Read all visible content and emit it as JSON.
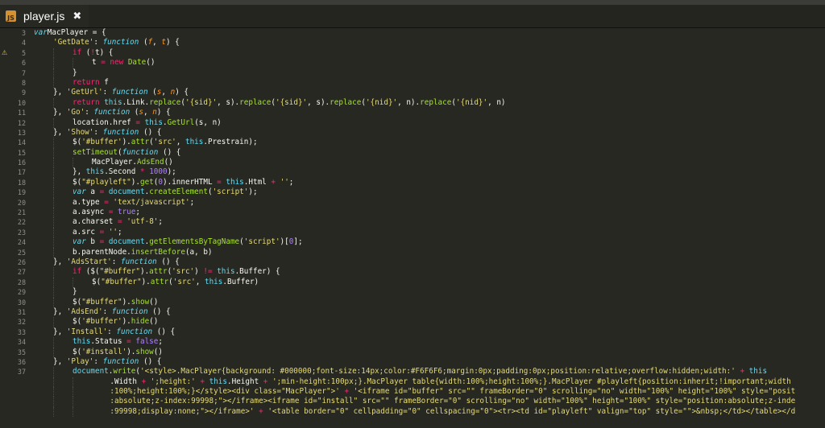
{
  "tab": {
    "icon_text": "JS",
    "name": "player.js",
    "close": "✖"
  },
  "warning_line": 5,
  "warning_glyph": "⚠",
  "lines": [
    {
      "n": "3",
      "indent": 0,
      "t": [
        [
          "v",
          "var"
        ],
        [
          "",
          "MacPlayer = {"
        ]
      ]
    },
    {
      "n": "4",
      "indent": 1,
      "t": [
        [
          "s",
          "'GetDate'"
        ],
        [
          "",
          ": "
        ],
        [
          "v",
          "function"
        ],
        [
          "",
          " ("
        ],
        [
          "p",
          "f"
        ],
        [
          "",
          ", "
        ],
        [
          "p",
          "t"
        ],
        [
          "",
          ") {"
        ]
      ]
    },
    {
      "n": "5",
      "indent": 2,
      "t": [
        [
          "k",
          "if"
        ],
        [
          "",
          " ("
        ],
        [
          "k",
          "!"
        ],
        [
          "",
          "t) {"
        ]
      ]
    },
    {
      "n": "6",
      "indent": 3,
      "t": [
        [
          "",
          "t "
        ],
        [
          "k",
          "="
        ],
        [
          " ",
          ""
        ],
        [
          "k",
          "new"
        ],
        [
          " ",
          ""
        ],
        [
          "f",
          "Date"
        ],
        [
          "",
          "()"
        ]
      ]
    },
    {
      "n": "7",
      "indent": 2,
      "t": [
        [
          "",
          "}"
        ]
      ]
    },
    {
      "n": "8",
      "indent": 2,
      "t": [
        [
          "k",
          "return"
        ],
        [
          "",
          " f"
        ]
      ]
    },
    {
      "n": "9",
      "indent": 1,
      "t": [
        [
          "",
          "}, "
        ],
        [
          "s",
          "'GetUrl'"
        ],
        [
          "",
          ": "
        ],
        [
          "v",
          "function"
        ],
        [
          "",
          " ("
        ],
        [
          "p",
          "s"
        ],
        [
          "",
          ", "
        ],
        [
          "p",
          "n"
        ],
        [
          "",
          ") {"
        ]
      ]
    },
    {
      "n": "10",
      "indent": 2,
      "t": [
        [
          "k",
          "return"
        ],
        [
          " ",
          ""
        ],
        [
          "c",
          "this"
        ],
        [
          "",
          ".Link."
        ],
        [
          "f",
          "replace"
        ],
        [
          "",
          "("
        ],
        [
          "s",
          "'{sid}'"
        ],
        [
          "",
          ", s)."
        ],
        [
          "f",
          "replace"
        ],
        [
          "",
          "("
        ],
        [
          "s",
          "'{sid}'"
        ],
        [
          "",
          ", s)."
        ],
        [
          "f",
          "replace"
        ],
        [
          "",
          "("
        ],
        [
          "s",
          "'{nid}'"
        ],
        [
          "",
          ", n)."
        ],
        [
          "f",
          "replace"
        ],
        [
          "",
          "("
        ],
        [
          "s",
          "'{nid}'"
        ],
        [
          "",
          ", n)"
        ]
      ]
    },
    {
      "n": "11",
      "indent": 1,
      "t": [
        [
          "",
          "}, "
        ],
        [
          "s",
          "'Go'"
        ],
        [
          "",
          ": "
        ],
        [
          "v",
          "function"
        ],
        [
          "",
          " ("
        ],
        [
          "p",
          "s"
        ],
        [
          "",
          ", "
        ],
        [
          "p",
          "n"
        ],
        [
          "",
          ") {"
        ]
      ]
    },
    {
      "n": "12",
      "indent": 2,
      "t": [
        [
          "",
          "location.href "
        ],
        [
          "k",
          "="
        ],
        [
          " ",
          ""
        ],
        [
          "c",
          "this"
        ],
        [
          "",
          "."
        ],
        [
          "f",
          "GetUrl"
        ],
        [
          "",
          "(s, n)"
        ]
      ]
    },
    {
      "n": "13",
      "indent": 1,
      "t": [
        [
          "",
          "}, "
        ],
        [
          "s",
          "'Show'"
        ],
        [
          "",
          ": "
        ],
        [
          "v",
          "function"
        ],
        [
          "",
          " () {"
        ]
      ]
    },
    {
      "n": "14",
      "indent": 2,
      "t": [
        [
          "",
          "$("
        ],
        [
          "s",
          "'#buffer'"
        ],
        [
          "",
          ")."
        ],
        [
          "f",
          "attr"
        ],
        [
          "",
          "("
        ],
        [
          "s",
          "'src'"
        ],
        [
          "",
          ", "
        ],
        [
          "c",
          "this"
        ],
        [
          "",
          ".Prestrain);"
        ]
      ]
    },
    {
      "n": "15",
      "indent": 2,
      "t": [
        [
          "f",
          "setTimeout"
        ],
        [
          "",
          "("
        ],
        [
          "v",
          "function"
        ],
        [
          "",
          " () {"
        ]
      ]
    },
    {
      "n": "16",
      "indent": 3,
      "t": [
        [
          "",
          "MacPlayer."
        ],
        [
          "f",
          "AdsEnd"
        ],
        [
          "",
          "()"
        ]
      ]
    },
    {
      "n": "17",
      "indent": 2,
      "t": [
        [
          "",
          "}, "
        ],
        [
          "c",
          "this"
        ],
        [
          "",
          ".Second "
        ],
        [
          "k",
          "*"
        ],
        [
          " ",
          ""
        ],
        [
          "n",
          "1000"
        ],
        [
          "",
          ");"
        ]
      ]
    },
    {
      "n": "18",
      "indent": 2,
      "t": [
        [
          "",
          "$("
        ],
        [
          "s",
          "\"#playleft\""
        ],
        [
          "",
          ")."
        ],
        [
          "f",
          "get"
        ],
        [
          "",
          "("
        ],
        [
          "n",
          "0"
        ],
        [
          "",
          ").innerHTML "
        ],
        [
          "k",
          "="
        ],
        [
          " ",
          ""
        ],
        [
          "c",
          "this"
        ],
        [
          "",
          ".Html "
        ],
        [
          "k",
          "+"
        ],
        [
          " ",
          ""
        ],
        [
          "s",
          "''"
        ],
        [
          "",
          ";"
        ]
      ]
    },
    {
      "n": "19",
      "indent": 2,
      "t": [
        [
          "v",
          "var"
        ],
        [
          "",
          " a "
        ],
        [
          "k",
          "="
        ],
        [
          " ",
          ""
        ],
        [
          "c",
          "document"
        ],
        [
          "",
          "."
        ],
        [
          "f",
          "createElement"
        ],
        [
          "",
          "("
        ],
        [
          "s",
          "'script'"
        ],
        [
          "",
          ");"
        ]
      ]
    },
    {
      "n": "20",
      "indent": 2,
      "t": [
        [
          "",
          "a.type "
        ],
        [
          "k",
          "="
        ],
        [
          " ",
          ""
        ],
        [
          "s",
          "'text/javascript'"
        ],
        [
          "",
          ";"
        ]
      ]
    },
    {
      "n": "21",
      "indent": 2,
      "t": [
        [
          "",
          "a.async "
        ],
        [
          "k",
          "="
        ],
        [
          " ",
          ""
        ],
        [
          "n",
          "true"
        ],
        [
          "",
          ";"
        ]
      ]
    },
    {
      "n": "22",
      "indent": 2,
      "t": [
        [
          "",
          "a.charset "
        ],
        [
          "k",
          "="
        ],
        [
          " ",
          ""
        ],
        [
          "s",
          "'utf-8'"
        ],
        [
          "",
          ";"
        ]
      ]
    },
    {
      "n": "23",
      "indent": 2,
      "t": [
        [
          "",
          "a.src "
        ],
        [
          "k",
          "="
        ],
        [
          " ",
          ""
        ],
        [
          "s",
          "''"
        ],
        [
          "",
          ";"
        ]
      ]
    },
    {
      "n": "24",
      "indent": 2,
      "t": [
        [
          "v",
          "var"
        ],
        [
          "",
          " b "
        ],
        [
          "k",
          "="
        ],
        [
          " ",
          ""
        ],
        [
          "c",
          "document"
        ],
        [
          "",
          "."
        ],
        [
          "f",
          "getElementsByTagName"
        ],
        [
          "",
          "("
        ],
        [
          "s",
          "'script'"
        ],
        [
          "",
          ")["
        ],
        [
          "n",
          "0"
        ],
        [
          "",
          "];"
        ]
      ]
    },
    {
      "n": "25",
      "indent": 2,
      "t": [
        [
          "",
          "b.parentNode."
        ],
        [
          "f",
          "insertBefore"
        ],
        [
          "",
          "(a, b)"
        ]
      ]
    },
    {
      "n": "26",
      "indent": 1,
      "t": [
        [
          "",
          "}, "
        ],
        [
          "s",
          "'AdsStart'"
        ],
        [
          "",
          ": "
        ],
        [
          "v",
          "function"
        ],
        [
          "",
          " () {"
        ]
      ]
    },
    {
      "n": "27",
      "indent": 2,
      "t": [
        [
          "k",
          "if"
        ],
        [
          "",
          " ($("
        ],
        [
          "s",
          "\"#buffer\""
        ],
        [
          "",
          ")."
        ],
        [
          "f",
          "attr"
        ],
        [
          "",
          "("
        ],
        [
          "s",
          "'src'"
        ],
        [
          "",
          ") "
        ],
        [
          "k",
          "!="
        ],
        [
          " ",
          ""
        ],
        [
          "c",
          "this"
        ],
        [
          "",
          ".Buffer) {"
        ]
      ]
    },
    {
      "n": "28",
      "indent": 3,
      "t": [
        [
          "",
          "$("
        ],
        [
          "s",
          "\"#buffer\""
        ],
        [
          "",
          ")."
        ],
        [
          "f",
          "attr"
        ],
        [
          "",
          "("
        ],
        [
          "s",
          "'src'"
        ],
        [
          "",
          ", "
        ],
        [
          "c",
          "this"
        ],
        [
          "",
          ".Buffer)"
        ]
      ]
    },
    {
      "n": "29",
      "indent": 2,
      "t": [
        [
          "",
          "}"
        ]
      ]
    },
    {
      "n": "30",
      "indent": 2,
      "t": [
        [
          "",
          "$("
        ],
        [
          "s",
          "\"#buffer\""
        ],
        [
          "",
          ")."
        ],
        [
          "f",
          "show"
        ],
        [
          "",
          "()"
        ]
      ]
    },
    {
      "n": "31",
      "indent": 1,
      "t": [
        [
          "",
          "}, "
        ],
        [
          "s",
          "'AdsEnd'"
        ],
        [
          "",
          ": "
        ],
        [
          "v",
          "function"
        ],
        [
          "",
          " () {"
        ]
      ]
    },
    {
      "n": "32",
      "indent": 2,
      "t": [
        [
          "",
          "$("
        ],
        [
          "s",
          "'#buffer'"
        ],
        [
          "",
          ")."
        ],
        [
          "f",
          "hide"
        ],
        [
          "",
          "()"
        ]
      ]
    },
    {
      "n": "33",
      "indent": 1,
      "t": [
        [
          "",
          "}, "
        ],
        [
          "s",
          "'Install'"
        ],
        [
          "",
          ": "
        ],
        [
          "v",
          "function"
        ],
        [
          "",
          " () {"
        ]
      ]
    },
    {
      "n": "34",
      "indent": 2,
      "t": [
        [
          "c",
          "this"
        ],
        [
          "",
          ".Status "
        ],
        [
          "k",
          "="
        ],
        [
          " ",
          ""
        ],
        [
          "n",
          "false"
        ],
        [
          "",
          ";"
        ]
      ]
    },
    {
      "n": "35",
      "indent": 2,
      "t": [
        [
          "",
          "$("
        ],
        [
          "s",
          "'#install'"
        ],
        [
          "",
          ")."
        ],
        [
          "f",
          "show"
        ],
        [
          "",
          "()"
        ]
      ]
    },
    {
      "n": "36",
      "indent": 1,
      "t": [
        [
          "",
          "}, "
        ],
        [
          "s",
          "'Play'"
        ],
        [
          "",
          ": "
        ],
        [
          "v",
          "function"
        ],
        [
          "",
          " () {"
        ]
      ]
    },
    {
      "n": "37",
      "indent": 2,
      "t": [
        [
          "c",
          "document"
        ],
        [
          "",
          "."
        ],
        [
          "f",
          "write"
        ],
        [
          "",
          "("
        ],
        [
          "s",
          "'<style>.MacPlayer{background: #000000;font-size:14px;color:#F6F6F6;margin:0px;padding:0px;position:relative;overflow:hidden;width:'"
        ],
        [
          "",
          " "
        ],
        [
          "k",
          "+"
        ],
        [
          " ",
          ""
        ],
        [
          "c",
          "this"
        ]
      ]
    },
    {
      "n": "",
      "indent": 3,
      "t": [
        [
          "",
          "    .Width "
        ],
        [
          "k",
          "+"
        ],
        [
          " ",
          ""
        ],
        [
          "s",
          "';height:'"
        ],
        [
          " ",
          ""
        ],
        [
          "k",
          "+"
        ],
        [
          " ",
          ""
        ],
        [
          "c",
          "this"
        ],
        [
          "",
          ".Height "
        ],
        [
          "k",
          "+"
        ],
        [
          " ",
          ""
        ],
        [
          "s",
          "';min-height:100px;}.MacPlayer table{width:100%;height:100%;}.MacPlayer #playleft{position:inherit;!important;width"
        ]
      ]
    },
    {
      "n": "",
      "indent": 3,
      "t": [
        [
          "s",
          "    :100%;height:100%;}</style><div class=\"MacPlayer\">'"
        ],
        [
          " ",
          ""
        ],
        [
          "k",
          "+"
        ],
        [
          " ",
          ""
        ],
        [
          "s",
          "'<iframe id=\"buffer\" src=\"\" frameBorder=\"0\" scrolling=\"no\" width=\"100%\" height=\"100%\" style=\"posit"
        ]
      ]
    },
    {
      "n": "",
      "indent": 3,
      "t": [
        [
          "s",
          "    :absolute;z-index:99998;\"></iframe><iframe id=\"install\" src=\"\" frameBorder=\"0\" scrolling=\"no\" width=\"100%\" height=\"100%\" style=\"position:absolute;z-inde"
        ]
      ]
    },
    {
      "n": "",
      "indent": 3,
      "t": [
        [
          "s",
          "    :99998;display:none;\"></iframe>'"
        ],
        [
          " ",
          ""
        ],
        [
          "k",
          "+"
        ],
        [
          " ",
          ""
        ],
        [
          "s",
          "'<table border=\"0\" cellpadding=\"0\" cellspacing=\"0\"><tr><td id=\"playleft\" valign=\"top\" style=\"\">&nbsp;</td></table></d"
        ]
      ]
    }
  ]
}
